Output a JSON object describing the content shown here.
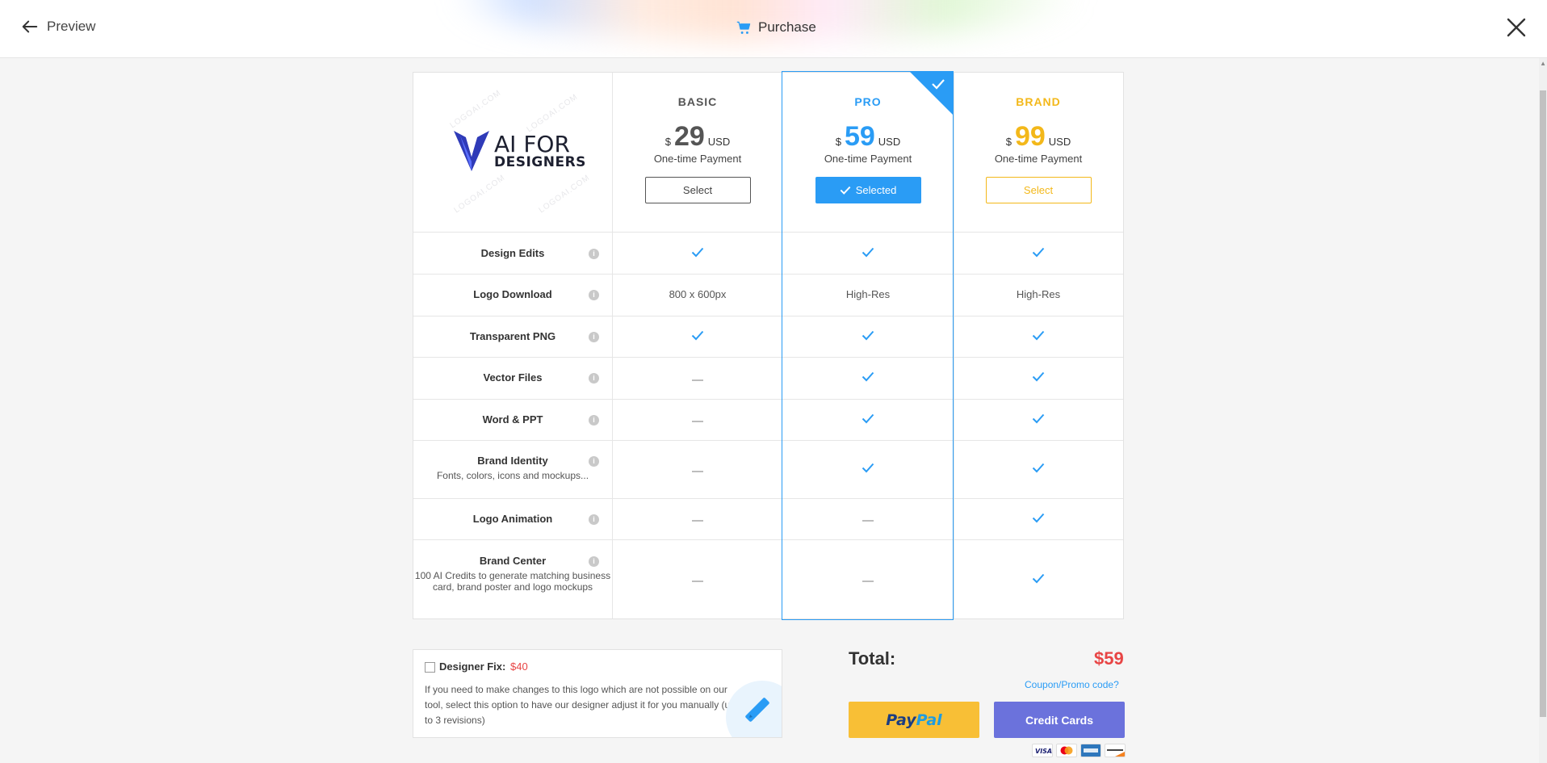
{
  "header": {
    "back_label": "Preview",
    "title": "Purchase"
  },
  "brand": {
    "line1": "AI FOR",
    "line2": "DESIGNERS",
    "watermark": "LOGOAI.COM"
  },
  "plans": [
    {
      "name": "BASIC",
      "currency": "$",
      "price": "29",
      "unit": "USD",
      "note": "One-time Payment",
      "button": "Select",
      "color": "#555555"
    },
    {
      "name": "PRO",
      "currency": "$",
      "price": "59",
      "unit": "USD",
      "note": "One-time Payment",
      "button": "Selected",
      "color": "#2a9cf5",
      "selected": true
    },
    {
      "name": "BRAND",
      "currency": "$",
      "price": "99",
      "unit": "USD",
      "note": "One-time Payment",
      "button": "Select",
      "color": "#f3b81a"
    }
  ],
  "features": [
    {
      "label": "Design Edits",
      "sub": "",
      "values": [
        "check",
        "check",
        "check"
      ]
    },
    {
      "label": "Logo Download",
      "sub": "",
      "values": [
        "800 x 600px",
        "High-Res",
        "High-Res"
      ]
    },
    {
      "label": "Transparent PNG",
      "sub": "",
      "values": [
        "check",
        "check",
        "check"
      ]
    },
    {
      "label": "Vector Files",
      "sub": "",
      "values": [
        "dash",
        "check",
        "check"
      ]
    },
    {
      "label": "Word & PPT",
      "sub": "",
      "values": [
        "dash",
        "check",
        "check"
      ]
    },
    {
      "label": "Brand Identity",
      "sub": "Fonts, colors, icons and mockups...",
      "values": [
        "dash",
        "check",
        "check"
      ]
    },
    {
      "label": "Logo Animation",
      "sub": "",
      "values": [
        "dash",
        "dash",
        "check"
      ]
    },
    {
      "label": "Brand Center",
      "sub": "100 AI Credits to generate matching business card, brand poster and logo mockups",
      "values": [
        "dash",
        "dash",
        "check"
      ]
    }
  ],
  "info_icon_glyph": "i",
  "designer_fix": {
    "title": "Designer Fix:",
    "price": "$40",
    "description": "If you need to make changes to this logo which are not possible on our tool, select this option to have our designer adjust it for you manually (up to 3 revisions)",
    "checked": false
  },
  "checkout": {
    "total_label": "Total:",
    "total_value": "$59",
    "coupon_label": "Coupon/Promo code?",
    "paypal_part1": "Pay",
    "paypal_part2": "Pal",
    "credit_cards_label": "Credit Cards",
    "card_icons": [
      "visa-icon",
      "mastercard-icon",
      "amex-icon",
      "discover-icon"
    ]
  },
  "colors": {
    "accent": "#2a9cf5",
    "brand_gold": "#f3b81a",
    "price_red": "#e84545",
    "credit_button": "#6b72dc",
    "paypal_button": "#f8bf36"
  }
}
